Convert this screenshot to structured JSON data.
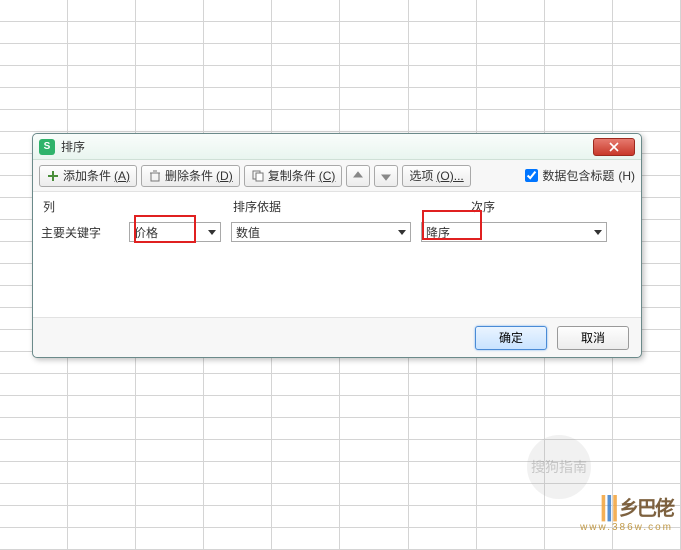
{
  "dialog": {
    "title": "排序",
    "toolbar": {
      "add": "添加条件",
      "add_key": "(A)",
      "del": "删除条件",
      "del_key": "(D)",
      "copy": "复制条件",
      "copy_key": "(C)",
      "options": "选项",
      "options_key": "(O)...",
      "has_header": "数据包含标题",
      "has_header_key": "(H)"
    },
    "headers": {
      "column": "列",
      "sort_by": "排序依据",
      "order": "次序"
    },
    "row": {
      "label": "主要关键字",
      "column_value": "价格",
      "basis_value": "数值",
      "order_value": "降序"
    },
    "footer": {
      "ok": "确定",
      "cancel": "取消"
    }
  },
  "watermark": {
    "circle": "搜狗指南",
    "logo_text": "乡巴佬",
    "url": "www.386w.com"
  }
}
